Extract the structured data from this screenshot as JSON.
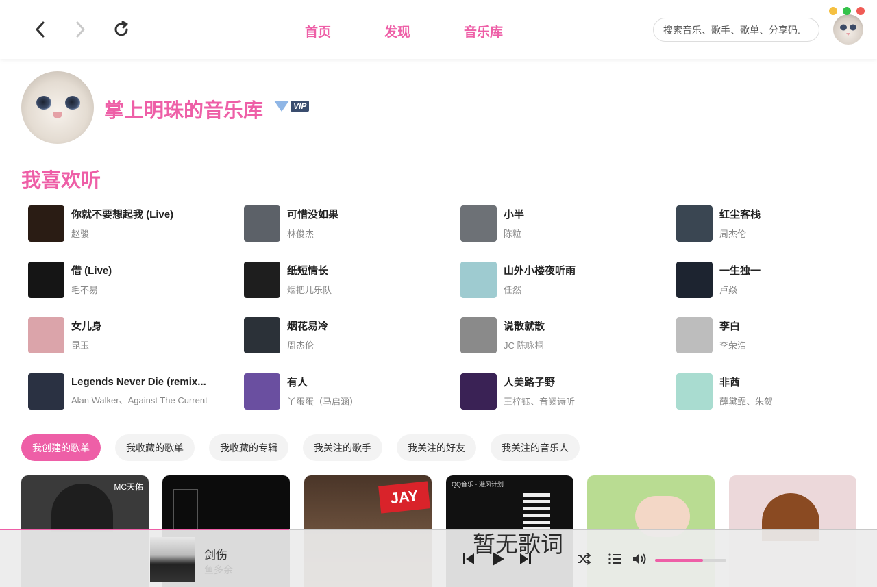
{
  "window": {
    "colors": {
      "minimize": "#f5c041",
      "maximize": "#34c24a",
      "close": "#f05b55"
    }
  },
  "topbar": {
    "nav": {
      "back_icon": "chevron-left-icon",
      "forward_icon": "chevron-right-icon",
      "refresh_icon": "refresh-icon"
    },
    "tabs": [
      "首页",
      "发现",
      "音乐库"
    ],
    "search": {
      "placeholder": "搜索音乐、歌手、歌单、分享码."
    }
  },
  "profile": {
    "name": "掌上明珠的音乐库",
    "badge": "VIP"
  },
  "favorites": {
    "title": "我喜欢听",
    "songs": [
      {
        "name": "你就不要想起我 (Live)",
        "artist": "赵骏",
        "color": "#2a1c14"
      },
      {
        "name": "可惜没如果",
        "artist": "林俊杰",
        "color": "#5c6168"
      },
      {
        "name": "小半",
        "artist": "陈粒",
        "color": "#6d7176"
      },
      {
        "name": "红尘客栈",
        "artist": "周杰伦",
        "color": "#3a4652"
      },
      {
        "name": "借 (Live)",
        "artist": "毛不易",
        "color": "#151515"
      },
      {
        "name": "纸短情长",
        "artist": "烟把儿乐队",
        "color": "#1e1e1e"
      },
      {
        "name": "山外小楼夜听雨",
        "artist": "任然",
        "color": "#9ecbd0"
      },
      {
        "name": "一生独一",
        "artist": "卢焱",
        "color": "#1d2430"
      },
      {
        "name": "女儿身",
        "artist": "昆玉",
        "color": "#dba4aa"
      },
      {
        "name": "烟花易冷",
        "artist": "周杰伦",
        "color": "#2b3138"
      },
      {
        "name": "说散就散",
        "artist": "JC 陈咏桐",
        "color": "#8a8a8a"
      },
      {
        "name": "李白",
        "artist": "李荣浩",
        "color": "#bdbdbd"
      },
      {
        "name": "Legends Never Die (remix...",
        "artist": "Alan Walker、Against The Current",
        "color": "#2a3142"
      },
      {
        "name": "有人",
        "artist": "丫蛋蛋（马启涵）",
        "color": "#6a4fa0"
      },
      {
        "name": "人美路子野",
        "artist": "王梓钰、音阙诗听",
        "color": "#3a2255"
      },
      {
        "name": "非酋",
        "artist": "薛黛霏、朱贺",
        "color": "#a9dcd0"
      }
    ]
  },
  "filters": {
    "items": [
      "我创建的歌单",
      "我收藏的歌单",
      "我收藏的专辑",
      "我关注的歌手",
      "我关注的好友",
      "我关注的音乐人"
    ],
    "active_index": 0
  },
  "playlists": [
    {
      "label": "MC天佑",
      "color": "#3a3a3a"
    },
    {
      "label": "",
      "color": "#0c0c0c"
    },
    {
      "label": "JAY",
      "color": "#6b4a36"
    },
    {
      "label": "QQ音乐 · 避风计划",
      "color": "#111111"
    },
    {
      "label": "",
      "color": "#b9dc92"
    },
    {
      "label": "",
      "color": "#ecd8da"
    }
  ],
  "player": {
    "title": "剑伤",
    "artist": "鱼多余",
    "lyric": "暂无歌词",
    "progress": 0.33,
    "volume": 0.67,
    "accent": "#ee5fa7"
  }
}
